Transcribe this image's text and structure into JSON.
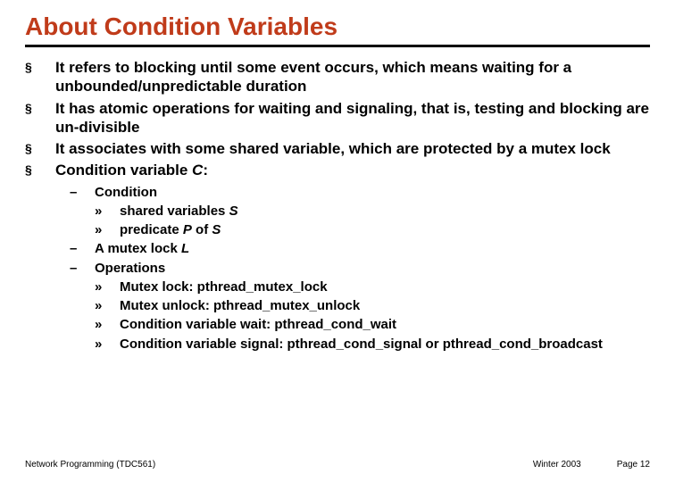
{
  "title": "About Condition Variables",
  "bullets": {
    "b1": "It refers to blocking until some event occurs, which means waiting for a unbounded/unpredictable duration",
    "b2": "It has atomic operations for waiting and signaling, that is, testing and blocking are un-divisible",
    "b3": "It associates with some shared variable, which are protected by a mutex lock",
    "b4_pre": "Condition variable ",
    "b4_i": "C",
    "b4_post": ":"
  },
  "sub": {
    "cond": "Condition",
    "shared_pre": "shared variables ",
    "shared_i": "S",
    "pred_pre": "predicate ",
    "pred_p": "P",
    "pred_mid": " of ",
    "pred_s": "S",
    "mutex_pre": "A mutex lock ",
    "mutex_i": "L",
    "ops": "Operations",
    "op1": "Mutex lock: pthread_mutex_lock",
    "op2": "Mutex unlock: pthread_mutex_unlock",
    "op3": "Condition variable wait: pthread_cond_wait",
    "op4": "Condition variable signal:  pthread_cond_signal or pthread_cond_broadcast"
  },
  "glyph": {
    "sq": "§",
    "dash": "–",
    "raquo": "»"
  },
  "footer": {
    "left": "Network Programming (TDC561)",
    "mid": "Winter  2003",
    "right": "Page 12"
  }
}
